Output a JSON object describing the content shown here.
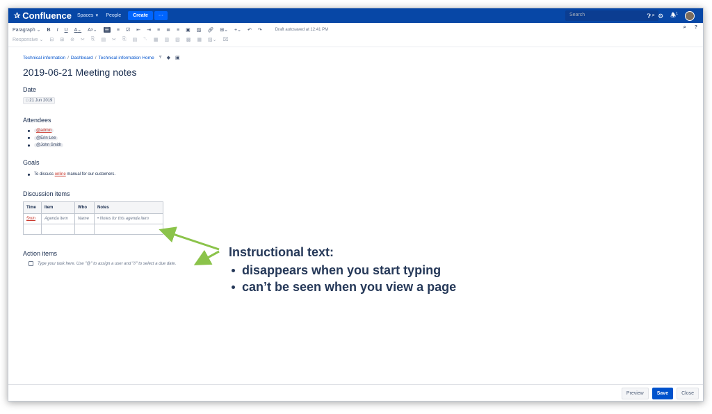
{
  "nav": {
    "logo_text": "Confluence",
    "spaces": "Spaces",
    "people": "People",
    "create": "Create",
    "more": "···",
    "search_placeholder": "Search",
    "notification_count": "1"
  },
  "toolbar": {
    "paragraph": "Paragraph",
    "bold": "B",
    "italic": "I",
    "underline": "U",
    "text_color": "A",
    "more_format": "A",
    "draft_status": "Draft autosaved at 12:41 PM",
    "responsive": "Responsive"
  },
  "breadcrumb": [
    "Technical information",
    "Dashboard",
    "Technical information Home"
  ],
  "page": {
    "title": "2019-06-21 Meeting notes",
    "date_heading": "Date",
    "date_value": "21 Jun 2019",
    "attendees_heading": "Attendees",
    "attendees": [
      "@admin",
      "@Erin Lee",
      "@John Smith"
    ],
    "goals_heading": "Goals",
    "goal_prefix": "To discuss ",
    "goal_link": "online",
    "goal_suffix": " manual for our customers.",
    "discussion_heading": "Discussion items",
    "table_headers": [
      "Time",
      "Item",
      "Who",
      "Notes"
    ],
    "table_row": [
      "5min",
      "Agenda item",
      "Name",
      "Notes for this agenda item"
    ],
    "action_heading": "Action items",
    "action_placeholder": "Type your task here. Use \"@\" to assign a user and \"//\" to select a due date."
  },
  "annotation": {
    "title": "Instructional text:",
    "bullets": [
      "disappears when you start typing",
      "can’t be seen when you view a page"
    ],
    "arrow_color": "#8bc34a"
  },
  "footer": {
    "preview": "Preview",
    "save": "Save",
    "close": "Close"
  }
}
